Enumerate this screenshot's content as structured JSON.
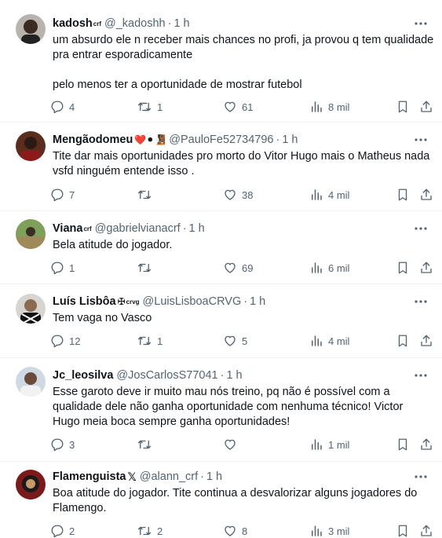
{
  "tweets": [
    {
      "name": "kadosh",
      "badge": "crf",
      "emoji": "",
      "handle": "@_kadoshh",
      "time": "1 h",
      "lines": [
        "um absurdo ele n receber mais chances no profi, ja provou q tem qualidade",
        "pra entrar esporadicamente"
      ],
      "extra_line": "pelo menos ter a oportunidade de mostrar futebol",
      "replies": "4",
      "retweets": "1",
      "likes": "61",
      "views": "8 mil"
    },
    {
      "name": "Mengãodomeu",
      "badge": "",
      "emoji": "❤️⚫🧏🏾",
      "handle": "@PauloFe52734796",
      "time": "1 h",
      "lines": [
        "Tite dar mais oportunidades pro morto do Vitor Hugo mais o Matheus nada",
        "vsfd ninguém entende isso ."
      ],
      "extra_line": "",
      "replies": "7",
      "retweets": "",
      "likes": "38",
      "views": "4 mil"
    },
    {
      "name": "Viana",
      "badge": "crf",
      "emoji": "",
      "handle": "@gabrielvianacrf",
      "time": "1 h",
      "lines": [
        "Bela atitude do jogador."
      ],
      "extra_line": "",
      "replies": "1",
      "retweets": "",
      "likes": "69",
      "views": "6 mil"
    },
    {
      "name": "Luís Lisbôa",
      "badge": "crvg",
      "emoji": "✠",
      "handle": "@LuisLisboaCRVG",
      "time": "1 h",
      "lines": [
        "Tem vaga no Vasco"
      ],
      "extra_line": "",
      "replies": "12",
      "retweets": "1",
      "likes": "5",
      "views": "4 mil"
    },
    {
      "name": "Jc_leosilva",
      "badge": "",
      "emoji": "",
      "handle": "@JosCarlosS77041",
      "time": "1 h",
      "lines": [
        "Esse garoto deve ir muito mau nós treino, pq não é possível com a",
        "qualidade dele não ganha oportunidade com nenhuma técnico! Victor",
        "Hugo meia boca sempre ganha oportunidades!"
      ],
      "extra_line": "",
      "replies": "3",
      "retweets": "",
      "likes": "",
      "views": "1 mil"
    },
    {
      "name": "Flamenguista",
      "badge": "",
      "emoji": "𝕏",
      "handle": "@alann_crf",
      "time": "1 h",
      "lines": [
        "Boa atitude do jogador. Tite continua a desvalorizar alguns jogadores do",
        "Flamengo."
      ],
      "extra_line": "",
      "replies": "2",
      "retweets": "2",
      "likes": "8",
      "views": "3 mil"
    }
  ],
  "colors": {
    "text": "#0f1419",
    "secondary": "#536471",
    "divider": "#eff3f4"
  },
  "icons": {
    "reply": "reply-icon",
    "retweet": "retweet-icon",
    "like": "heart-icon",
    "views": "views-icon",
    "bookmark": "bookmark-icon",
    "share": "share-icon",
    "more": "more-icon"
  }
}
